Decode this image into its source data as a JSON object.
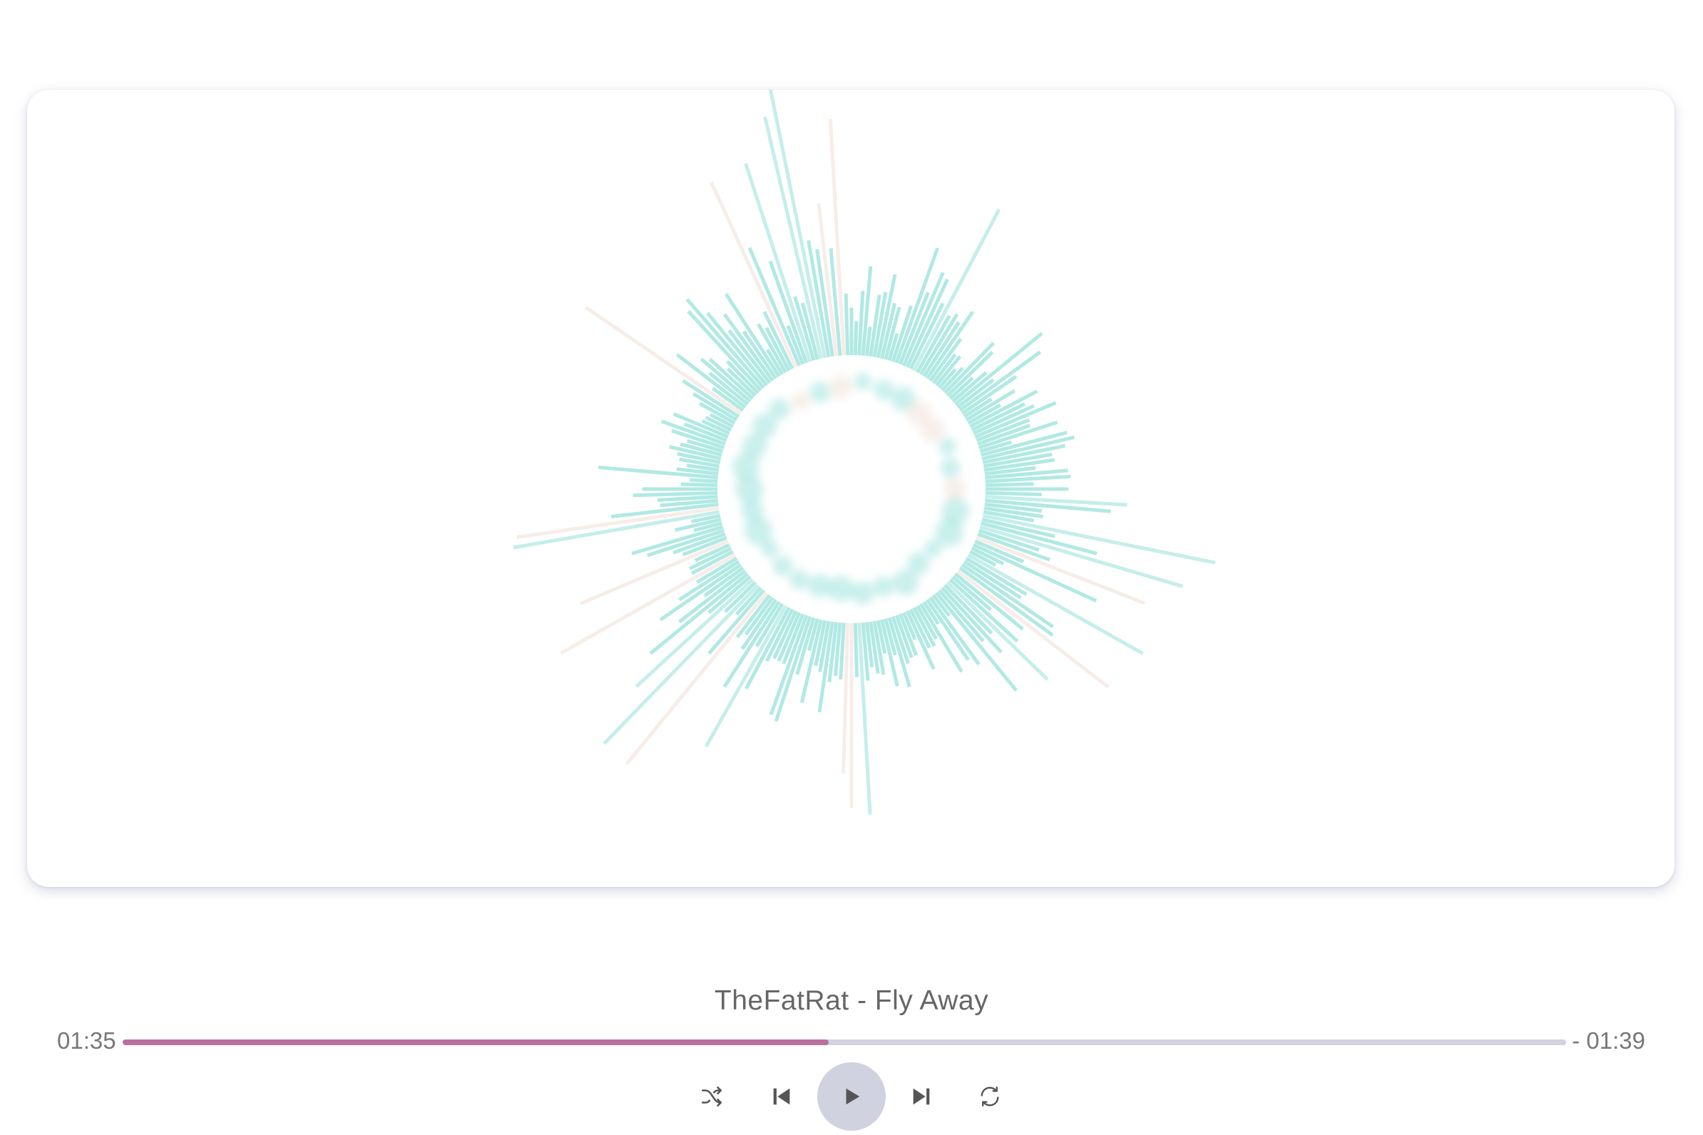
{
  "player": {
    "track_title": "TheFatRat - Fly Away",
    "time_elapsed": "01:35",
    "time_remaining": "- 01:39",
    "progress_fraction": 0.489
  },
  "controls": {
    "shuffle_icon": "shuffle-icon",
    "previous_icon": "skip-previous-icon",
    "play_icon": "play-icon",
    "next_icon": "skip-next-icon",
    "repeat_icon": "repeat-icon"
  },
  "colors": {
    "progress_fill": "#b9709f",
    "progress_track": "#d2d3df",
    "play_button_bg": "#d1d2df",
    "visualizer_bar": "#9ee3dc",
    "visualizer_bar_alt": "#f1e1d8",
    "icon": "#555555"
  }
}
